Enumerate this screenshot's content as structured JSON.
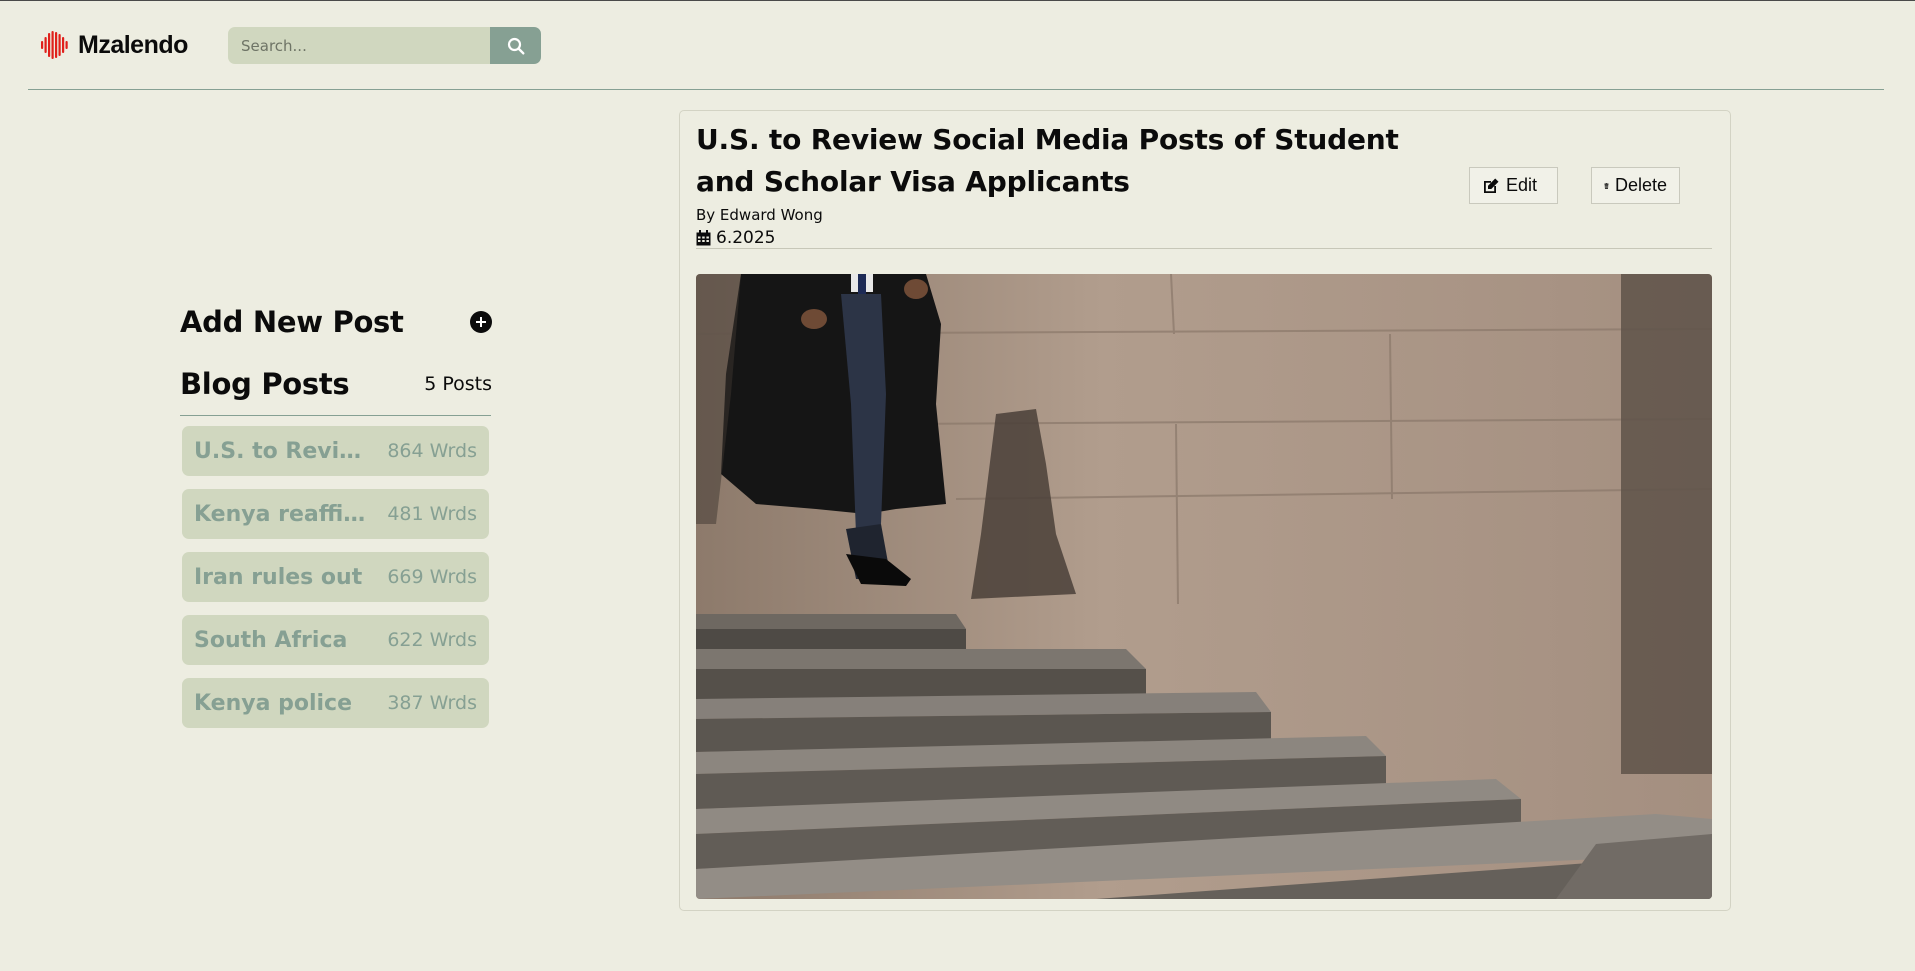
{
  "brand": {
    "name": "Mzalendo",
    "color": "#e0201b"
  },
  "search": {
    "placeholder": "Search...",
    "icon": "search-icon"
  },
  "sidebar": {
    "add_heading": "Add New Post",
    "blog_heading": "Blog Posts",
    "post_count": "5 Posts",
    "posts": [
      {
        "title": "U.S. to Review Social Media Posts of Student and Scholar Visa Applicants",
        "words": "864 Wrds"
      },
      {
        "title": "Kenya reaffirms",
        "words": "481 Wrds"
      },
      {
        "title": "Iran rules out",
        "words": "669 Wrds"
      },
      {
        "title": "South Africa",
        "words": "622 Wrds"
      },
      {
        "title": "Kenya police",
        "words": "387 Wrds"
      }
    ]
  },
  "article": {
    "title": "U.S. to Review Social Media Posts of Student and Scholar Visa Applicants",
    "author": "By Edward Wong",
    "date": "6.2025",
    "edit_label": "Edit",
    "delete_label": "Delete",
    "image_alt": "Person in graduation gown walking down stone steps"
  },
  "colors": {
    "background": "#edede1",
    "accent": "#86a093",
    "panel": "#d0d7bf",
    "text": "#0b0b0b"
  }
}
